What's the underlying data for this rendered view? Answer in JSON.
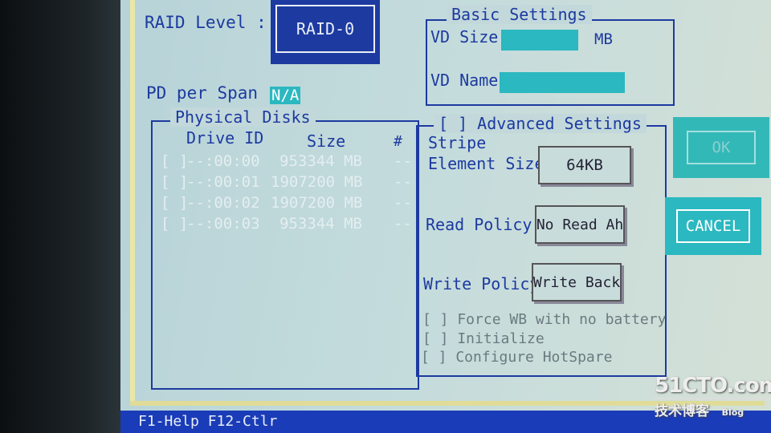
{
  "raid_level": {
    "label": "RAID Level :",
    "value": "RAID-0"
  },
  "pd_per_span": {
    "label": "PD per Span :",
    "value": "N/A"
  },
  "physical_disks": {
    "title": "Physical Disks",
    "headers": {
      "drive_id": "Drive ID",
      "size": "Size",
      "num": "#"
    },
    "rows": [
      {
        "check": "[ ]",
        "drive_id": "--:00:00",
        "size": "953344 MB",
        "num": "--"
      },
      {
        "check": "[ ]",
        "drive_id": "--:00:01",
        "size": "1907200 MB",
        "num": "--"
      },
      {
        "check": "[ ]",
        "drive_id": "--:00:02",
        "size": "1907200 MB",
        "num": "--"
      },
      {
        "check": "[ ]",
        "drive_id": "--:00:03",
        "size": "953344 MB",
        "num": "--"
      }
    ]
  },
  "basic_settings": {
    "title": "Basic Settings",
    "vd_size_label": "VD Size:",
    "vd_size_unit": "MB",
    "vd_name_label": "VD Name:"
  },
  "advanced_settings": {
    "title": "[ ] Advanced Settings",
    "stripe_label_1": "Stripe",
    "stripe_label_2": "Element Size:",
    "stripe_value": "64KB",
    "read_policy_label": "Read Policy :",
    "read_policy_value": "No Read Ah",
    "write_policy_label": "Write Policy:",
    "write_policy_value": "Write Back",
    "options": [
      "[ ] Force WB with no battery",
      "[ ] Initialize",
      "[ ] Configure HotSpare"
    ]
  },
  "buttons": {
    "ok": "OK",
    "cancel": "CANCEL"
  },
  "status_bar": "F1-Help F12-Ctlr",
  "watermark": {
    "site": "51CTO.com",
    "sub": "技术博客",
    "blog": "Blog"
  },
  "colors": {
    "accent": "#1c3aa0",
    "field": "#2bb8c0",
    "button_active": "#2bb8c0"
  }
}
